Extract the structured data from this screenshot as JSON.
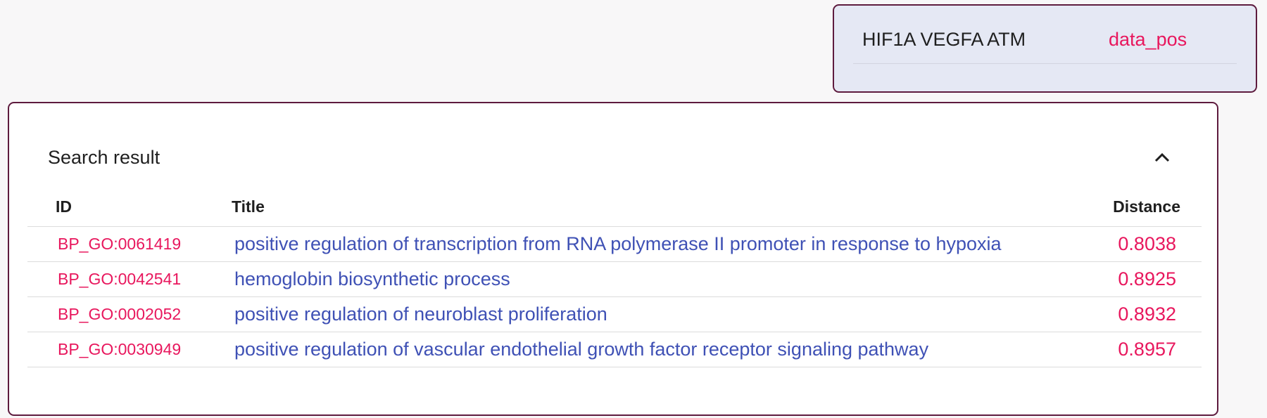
{
  "query": {
    "genes": "HIF1A VEGFA ATM",
    "source": "data_pos"
  },
  "result": {
    "title": "Search result",
    "columns": {
      "id": "ID",
      "title": "Title",
      "distance": "Distance"
    },
    "rows": [
      {
        "id": "BP_GO:0061419",
        "title": "positive regulation of transcription from RNA polymerase II promoter in response to hypoxia",
        "distance": "0.8038"
      },
      {
        "id": "BP_GO:0042541",
        "title": "hemoglobin biosynthetic process",
        "distance": "0.8925"
      },
      {
        "id": "BP_GO:0002052",
        "title": "positive regulation of neuroblast proliferation",
        "distance": "0.8932"
      },
      {
        "id": "BP_GO:0030949",
        "title": "positive regulation of vascular endothelial growth factor receptor signaling pathway",
        "distance": "0.8957"
      }
    ]
  },
  "icons": {
    "collapse": "chevron-up-icon"
  },
  "colors": {
    "accent": "#e8175d",
    "link": "#3f51b5",
    "border": "#5e1b3e",
    "query_card_bg": "#e5e8f4"
  }
}
